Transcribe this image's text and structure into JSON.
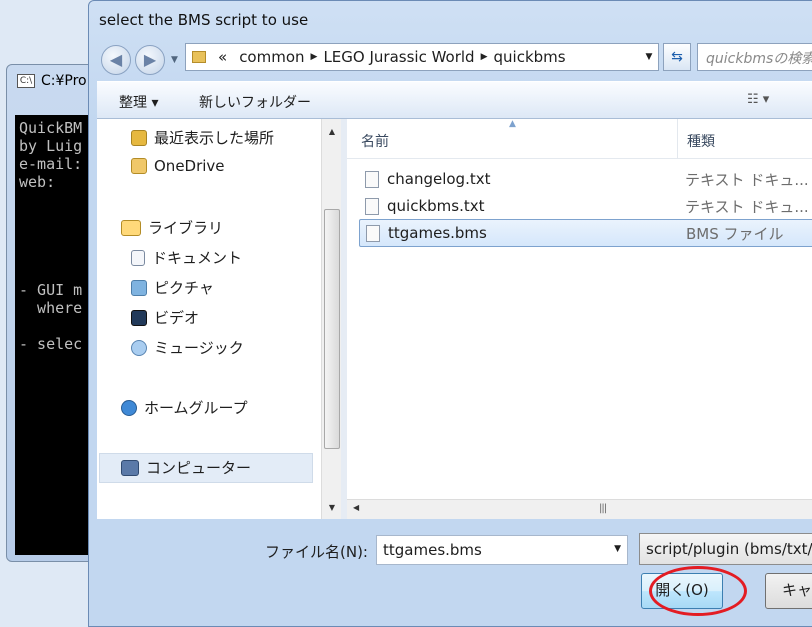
{
  "console": {
    "title": "C:¥Pro",
    "icon": "cmd-icon",
    "lines": "QuickBM\nby Luig\ne-mail:\nweb:\n\n\n\n\n\n- GUI m\n  where\n\n- selec"
  },
  "dialog": {
    "title": "select the BMS script to use",
    "address": {
      "prefix": "«",
      "segments": [
        "common",
        "LEGO Jurassic World",
        "quickbms"
      ]
    },
    "search_placeholder": "quickbmsの検索",
    "toolbar": {
      "organize": "整理 ▾",
      "new_folder": "新しいフォルダー"
    },
    "nav": {
      "recent": "最近表示した場所",
      "onedrive": "OneDrive",
      "libraries": "ライブラリ",
      "documents": "ドキュメント",
      "pictures": "ピクチャ",
      "videos": "ビデオ",
      "music": "ミュージック",
      "homegroup": "ホームグループ",
      "computer": "コンピューター"
    },
    "columns": {
      "name": "名前",
      "type": "種類"
    },
    "files": [
      {
        "name": "changelog.txt",
        "type": "テキスト ドキュ..."
      },
      {
        "name": "quickbms.txt",
        "type": "テキスト ドキュ..."
      },
      {
        "name": "ttgames.bms",
        "type": "BMS ファイル"
      }
    ],
    "filename_label": "ファイル名(N):",
    "filename_value": "ttgames.bms",
    "filter_value": "script/plugin (bms/txt/",
    "open_label": "開く(O)",
    "cancel_label": "キャ",
    "highlight_color": "#e31c23",
    "selection_color": "#d5e7fb"
  }
}
